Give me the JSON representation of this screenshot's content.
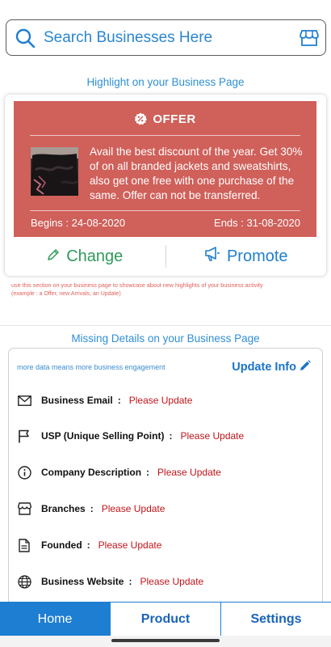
{
  "search": {
    "placeholder": "Search Businesses Here"
  },
  "highlight": {
    "section_title": "Highlight on your Business Page",
    "offer": {
      "heading": "OFFER",
      "description": "Avail the best discount of the year. Get 30% of on all branded jackets and sweatshirts, also get one free with one purchase of the same. Offer can not be transferred.",
      "begins": "Begins : 24-08-2020",
      "ends": "Ends : 31-08-2020",
      "background_color": "#d0605a"
    },
    "change_label": "Change",
    "promote_label": "Promote",
    "hint_line1": "use this section on your business page to showcase about new highlights of your business activity",
    "hint_line2": "(example : a Offer, new Arrivals, an Update)"
  },
  "missing_details": {
    "section_title": "Missing Details on your Business Page",
    "subtitle": "more data means more business engagement",
    "update_label": "Update Info",
    "rows": [
      {
        "icon": "mail-icon",
        "label": "Business Email",
        "value": "Please Update"
      },
      {
        "icon": "flag-icon",
        "label": "USP (Unique Selling Point)",
        "value": "Please Update"
      },
      {
        "icon": "info-icon",
        "label": "Company Description",
        "value": "Please Update"
      },
      {
        "icon": "store-icon",
        "label": "Branches",
        "value": "Please Update"
      },
      {
        "icon": "document-icon",
        "label": "Founded",
        "value": "Please Update"
      },
      {
        "icon": "globe-icon",
        "label": "Business Website",
        "value": "Please Update"
      }
    ],
    "colon": ":"
  },
  "tabs": {
    "home": "Home",
    "product": "Product",
    "settings": "Settings",
    "active": "home",
    "accent_color": "#1e7ed2"
  }
}
